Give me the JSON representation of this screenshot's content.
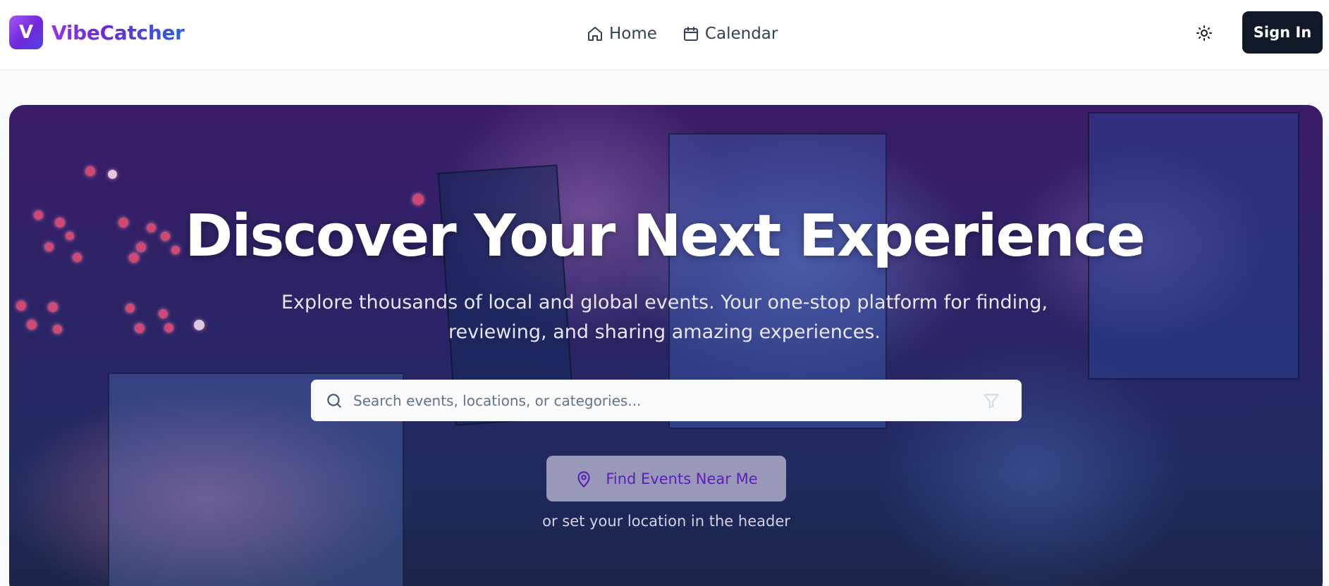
{
  "brand": {
    "logo_letter": "V",
    "name": "VibeCatcher"
  },
  "nav": {
    "items": [
      {
        "label": "Home",
        "icon": "home-icon"
      },
      {
        "label": "Calendar",
        "icon": "calendar-icon"
      }
    ]
  },
  "header": {
    "theme_icon": "sun-icon",
    "signin_label": "Sign In"
  },
  "hero": {
    "title": "Discover Your Next Experience",
    "subtitle": "Explore thousands of local and global events. Your one-stop platform for finding, reviewing, and sharing amazing experiences.",
    "search": {
      "placeholder": "Search events, locations, or categories...",
      "value": ""
    },
    "near_button_label": "Find Events Near Me",
    "location_hint": "or set your location in the header"
  },
  "colors": {
    "brand_gradient_start": "#9333ea",
    "brand_gradient_end": "#2563eb",
    "signin_bg": "#111827",
    "near_button_text": "#5b21b6"
  }
}
